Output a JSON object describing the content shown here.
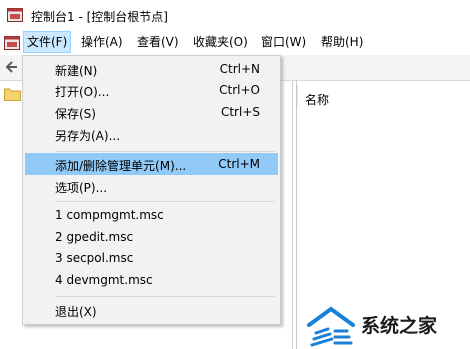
{
  "window": {
    "title": "控制台1 - [控制台根节点]"
  },
  "menubar": {
    "items": [
      {
        "label": "文件(F)",
        "active": true
      },
      {
        "label": "操作(A)"
      },
      {
        "label": "查看(V)"
      },
      {
        "label": "收藏夹(O)"
      },
      {
        "label": "窗口(W)"
      },
      {
        "label": "帮助(H)"
      }
    ]
  },
  "right_pane": {
    "column_header": "名称"
  },
  "file_menu": {
    "items": [
      {
        "label": "新建(N)",
        "shortcut": "Ctrl+N"
      },
      {
        "label": "打开(O)...",
        "shortcut": "Ctrl+O"
      },
      {
        "label": "保存(S)",
        "shortcut": "Ctrl+S"
      },
      {
        "label": "另存为(A)..."
      },
      {
        "label": "添加/删除管理单元(M)...",
        "shortcut": "Ctrl+M",
        "highlighted": true
      },
      {
        "label": "选项(P)..."
      },
      {
        "label": "1 compmgmt.msc"
      },
      {
        "label": "2 gpedit.msc"
      },
      {
        "label": "3 secpol.msc"
      },
      {
        "label": "4 devmgmt.msc"
      },
      {
        "label": "退出(X)"
      }
    ]
  },
  "watermark": {
    "text": "系统之家",
    "brand_color": "#1a7fd6"
  }
}
